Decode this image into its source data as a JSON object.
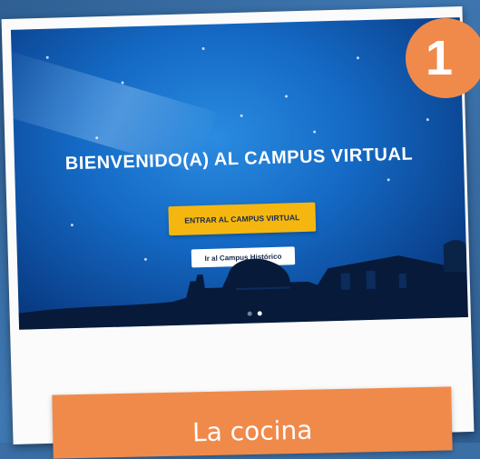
{
  "hero": {
    "welcome_text": "BIENVENIDO(A) AL CAMPUS VIRTUAL",
    "enter_button_label": "ENTRAR AL CAMPUS VIRTUAL",
    "history_button_label": "Ir al Campus Histórico"
  },
  "carousel": {
    "slides": 2,
    "active": 1
  },
  "badge": {
    "number": "1"
  },
  "caption": {
    "text": "La cocina"
  },
  "colors": {
    "accent_orange": "#f08a4b",
    "button_yellow": "#f5b70f",
    "hero_blue": "#1469c4"
  }
}
